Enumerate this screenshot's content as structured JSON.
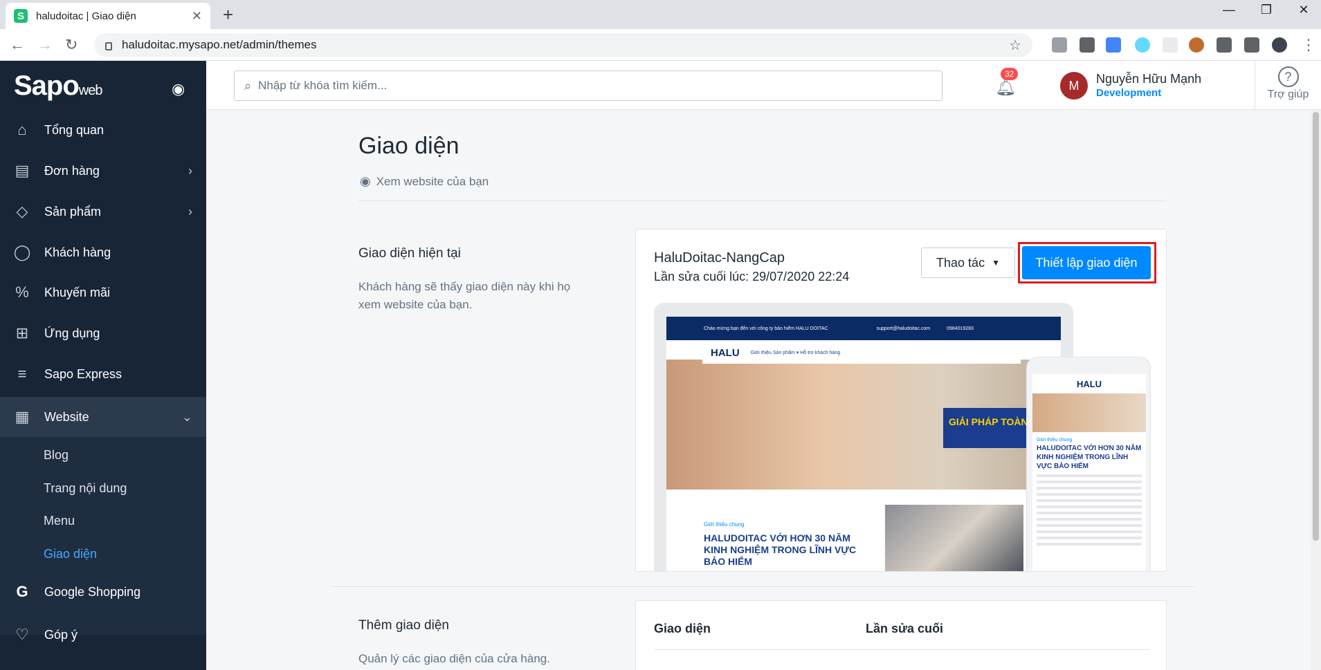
{
  "browser": {
    "tab_title": "haludoitac | Giao diện",
    "favicon_letter": "S",
    "url": "haludoitac.mysapo.net/admin/themes"
  },
  "sidebar": {
    "logo": "Sapo",
    "logo_suffix": "web",
    "items": [
      {
        "label": "Tổng quan",
        "icon": "home-icon"
      },
      {
        "label": "Đơn hàng",
        "icon": "order-icon"
      },
      {
        "label": "Sản phẩm",
        "icon": "box-icon"
      },
      {
        "label": "Khách hàng",
        "icon": "user-icon"
      },
      {
        "label": "Khuyến mãi",
        "icon": "percent-icon"
      },
      {
        "label": "Ứng dụng",
        "icon": "apps-icon"
      },
      {
        "label": "Sapo Express",
        "icon": "express-icon"
      },
      {
        "label": "Website",
        "icon": "website-icon"
      },
      {
        "label": "Google Shopping",
        "icon": "google-icon"
      },
      {
        "label": "Góp ý",
        "icon": "feedback-icon"
      }
    ],
    "website_sub": [
      "Blog",
      "Trang nội dung",
      "Menu",
      "Giao diện"
    ]
  },
  "header": {
    "search_placeholder": "Nhập từ khóa tìm kiếm...",
    "notif_count": "32",
    "avatar_letter": "M",
    "user_name": "Nguyễn Hữu Mạnh",
    "user_role": "Development",
    "help_label": "Trợ giúp"
  },
  "main": {
    "title": "Giao diện",
    "view_link": "Xem website của bạn",
    "current": {
      "title": "Giao diện hiện tại",
      "desc": "Khách hàng sẽ thấy giao diện này khi họ xem website của bạn.",
      "theme_name": "HaluDoitac-NangCap",
      "last_edit": "Lần sửa cuối lúc: 29/07/2020 22:24",
      "action_btn": "Thao tác",
      "setup_btn": "Thiết lập giao diện"
    },
    "add": {
      "title": "Thêm giao diện",
      "desc": "Quản lý các giao diện của cửa hàng.",
      "col_theme": "Giao diện",
      "col_edited": "Lần sửa cuối"
    }
  },
  "preview": {
    "top_welcome": "Chào mừng bạn đến với công ty bảo hiểm HALU DOITAC",
    "top_email": "support@haludoitac.com",
    "top_phone": "0984019283",
    "logo": "HALU",
    "nav": "Giới thiệu   Sản phẩm ▾   Hỗ trợ khách hàng",
    "banner": "GIẢI PHÁP TOÀN",
    "intro_small": "Giới thiệu chung",
    "intro_title": "HALUDOITAC VỚI HƠN 30 NĂM KINH NGHIỆM TRONG LĨNH VỰC BẢO HIỂM",
    "mobile_title": "HALUDOITAC VỚI HƠN 30 NĂM KINH NGHIỆM TRONG LĨNH VỰC BẢO HIỂM"
  }
}
